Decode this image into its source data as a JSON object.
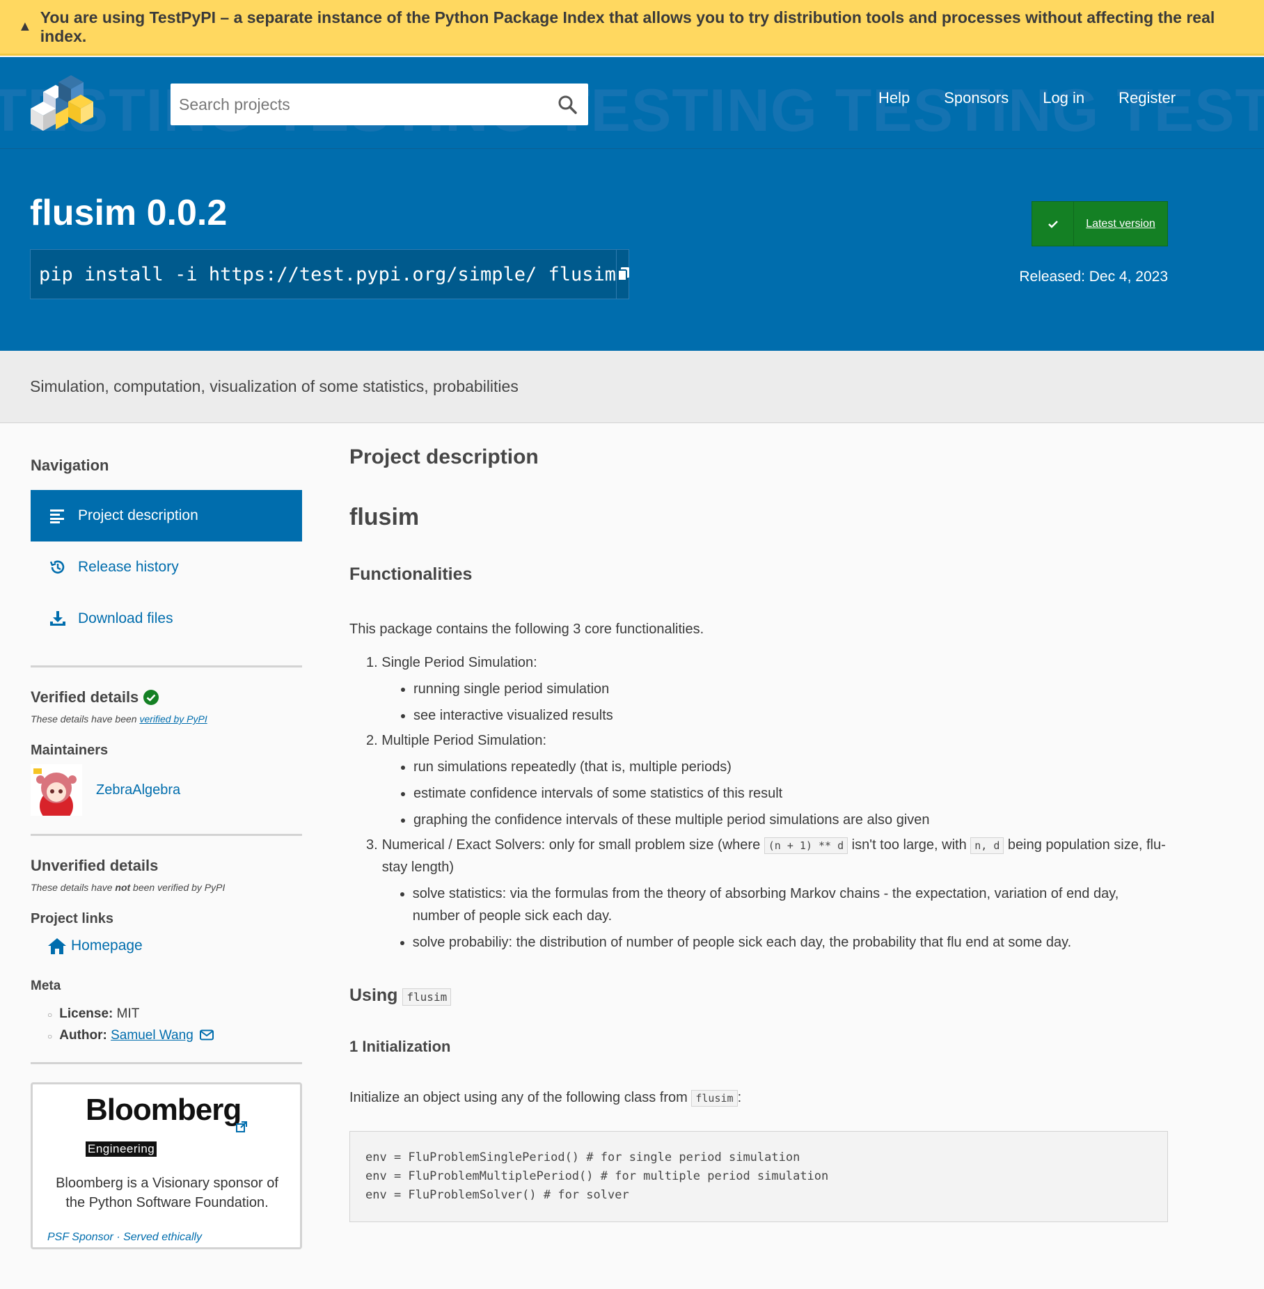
{
  "banner": {
    "text": "You are using TestPyPI – a separate instance of the Python Package Index that allows you to try distribution tools and processes without affecting the real index."
  },
  "header": {
    "watermark": "TESTING TESTING TESTING TESTING TESTING TESTING TESTING",
    "search_placeholder": "Search projects",
    "nav": [
      "Help",
      "Sponsors",
      "Log in",
      "Register"
    ]
  },
  "hero": {
    "title": "flusim 0.0.2",
    "pip_command": "pip install -i https://test.pypi.org/simple/ flusim",
    "latest_label": "Latest version",
    "released": "Released: Dec 4, 2023"
  },
  "summary": "Simulation, computation, visualization of some statistics, probabilities",
  "sidebar": {
    "navigation_title": "Navigation",
    "nav_items": [
      "Project description",
      "Release history",
      "Download files"
    ],
    "verified_title": "Verified details",
    "verified_note_prefix": "These details have been ",
    "verified_note_link": "verified by PyPI",
    "maintainers_title": "Maintainers",
    "maintainer": "ZebraAlgebra",
    "unverified_title": "Unverified details",
    "unverified_note_prefix": "These details have ",
    "unverified_note_bold": "not",
    "unverified_note_suffix": " been verified by PyPI",
    "project_links_title": "Project links",
    "homepage": "Homepage",
    "meta_title": "Meta",
    "license_label": "License:",
    "license_value": "MIT",
    "author_label": "Author:",
    "author_value": "Samuel Wang",
    "sponsor_name": "Bloomberg",
    "sponsor_tag": "Engineering",
    "sponsor_text": "Bloomberg is a Visionary sponsor of the Python Software Foundation.",
    "sponsor_link1": "PSF Sponsor",
    "sponsor_sep": "·",
    "sponsor_link2": "Served ethically"
  },
  "main": {
    "project_description": "Project description",
    "h_flusim": "flusim",
    "h_functionalities": "Functionalities",
    "intro": "This package contains the following 3 core functionalities.",
    "item1": {
      "num": "1.",
      "title": "Single Period Simulation:",
      "bullets": [
        "running single period simulation",
        "see interactive visualized results"
      ]
    },
    "item2": {
      "num": "2.",
      "title": "Multiple Period Simulation:",
      "bullets": [
        "run simulations repeatedly (that is, multiple periods)",
        "estimate confidence intervals of some statistics of this result",
        "graphing the confidence intervals of these multiple period simulations are also given"
      ]
    },
    "item3": {
      "num": "3.",
      "t1": "Numerical / Exact Solvers: only for small problem size (where ",
      "c1": "(n + 1) ** d",
      "t2": " isn't too large, with ",
      "c2": "n, d",
      "t3": " being population size, flu-stay length)",
      "bullets": [
        "solve statistics: via the formulas from the theory of absorbing Markov chains - the expectation, variation of end day, number of people sick each day.",
        "solve probabiliy: the distribution of number of people sick each day, the probability that flu end at some day."
      ]
    },
    "using_title": "Using",
    "using_code": "flusim",
    "init_title": "1 Initialization",
    "init_text": "Initialize an object using any of the following class from ",
    "init_code": "flusim",
    "init_colon": ":",
    "code_lines": [
      "env = FluProblemSinglePeriod() # for single period simulation",
      "env = FluProblemMultiplePeriod() # for multiple period simulation",
      "env = FluProblemSolver() # for solver"
    ]
  },
  "colors": {
    "brand_blue": "#006dad",
    "banner_yellow": "#ffd860",
    "verified_green": "#148024"
  }
}
